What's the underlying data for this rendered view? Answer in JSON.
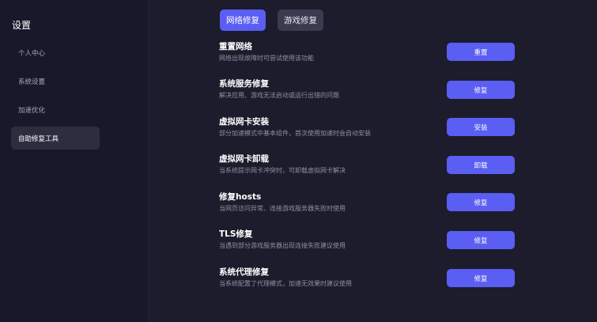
{
  "sidebar": {
    "title": "设置",
    "items": [
      {
        "label": "个人中心",
        "active": false
      },
      {
        "label": "系统设置",
        "active": false
      },
      {
        "label": "加速优化",
        "active": false
      },
      {
        "label": "自助修复工具",
        "active": true
      }
    ]
  },
  "tabs": [
    {
      "label": "网络修复",
      "active": true
    },
    {
      "label": "游戏修复",
      "active": false
    }
  ],
  "repairs": [
    {
      "title": "重置网络",
      "desc": "网络出现故障时可尝试使用该功能",
      "button": "重置"
    },
    {
      "title": "系统服务修复",
      "desc": "解决应用、游戏无法启动或运行出错的问题",
      "button": "修复"
    },
    {
      "title": "虚拟网卡安装",
      "desc": "部分加速模式中基本组件，首次使用加速时会自动安装",
      "button": "安装"
    },
    {
      "title": "虚拟网卡卸载",
      "desc": "当系统提示网卡冲突时，可卸载虚拟网卡解决",
      "button": "卸载"
    },
    {
      "title": "修复hosts",
      "desc": "当网页访问异常、连接游戏服务器失败时使用",
      "button": "修复"
    },
    {
      "title": "TLS修复",
      "desc": "当遇到部分游戏服务器出现连接失败建议使用",
      "button": "修复"
    },
    {
      "title": "系统代理修复",
      "desc": "当系统配置了代理模式，加速无效果时建议使用",
      "button": "修复"
    }
  ],
  "colors": {
    "background": "#1c1c2c",
    "sidebar": "#18182a",
    "accent": "#5a5ef2",
    "inactive_tab": "#3b3b50",
    "active_item": "#2d2d40"
  }
}
